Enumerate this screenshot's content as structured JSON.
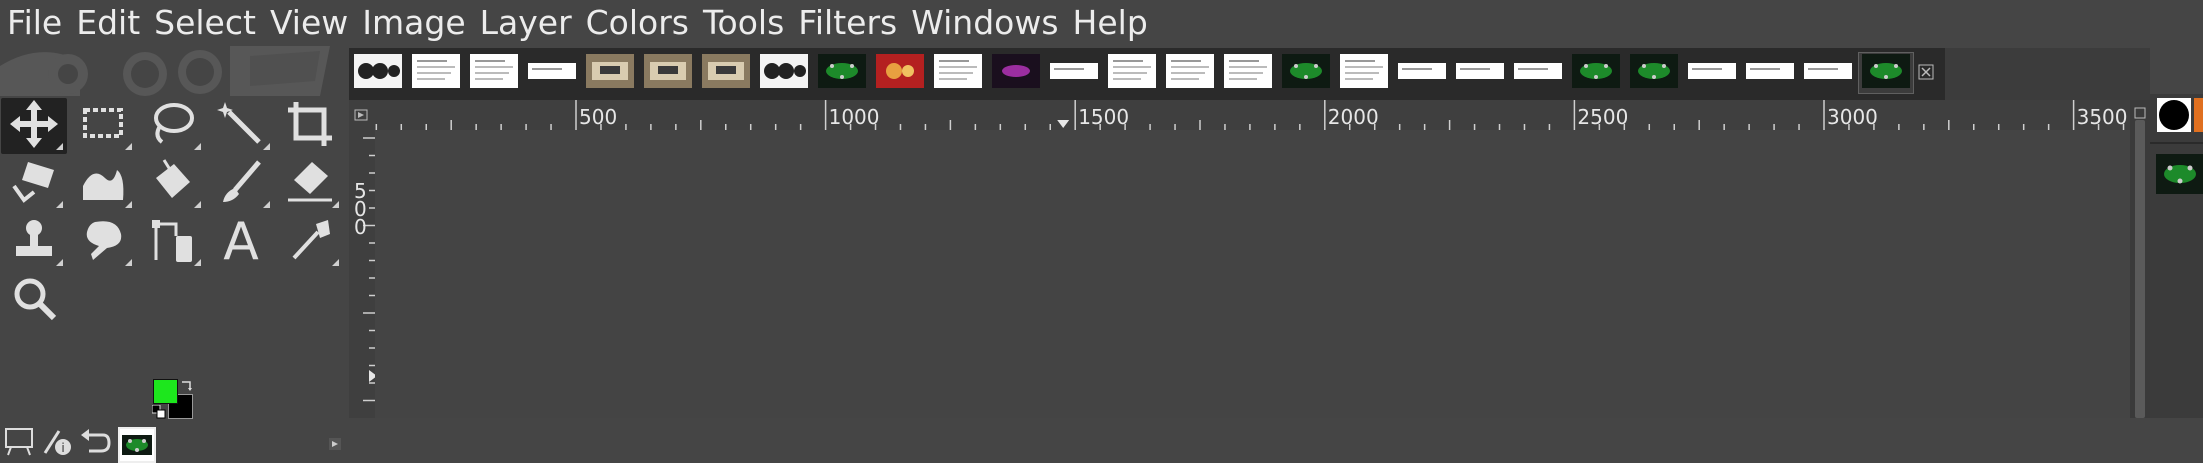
{
  "menubar": {
    "items": [
      "File",
      "Edit",
      "Select",
      "View",
      "Image",
      "Layer",
      "Colors",
      "Tools",
      "Filters",
      "Windows",
      "Help"
    ]
  },
  "toolbox": {
    "tools": [
      {
        "name": "move-tool",
        "icon": "move-icon",
        "active": true
      },
      {
        "name": "rect-select-tool",
        "icon": "rect-select-icon"
      },
      {
        "name": "free-select-tool",
        "icon": "lasso-icon"
      },
      {
        "name": "fuzzy-select-tool",
        "icon": "magic-wand-icon"
      },
      {
        "name": "crop-tool",
        "icon": "crop-icon"
      },
      {
        "name": "unified-transform-tool",
        "icon": "transform-icon"
      },
      {
        "name": "warp-transform-tool",
        "icon": "warp-icon"
      },
      {
        "name": "bucket-fill-tool",
        "icon": "bucket-icon"
      },
      {
        "name": "paintbrush-tool",
        "icon": "paintbrush-icon"
      },
      {
        "name": "eraser-tool",
        "icon": "eraser-icon"
      },
      {
        "name": "clone-tool",
        "icon": "stamp-icon"
      },
      {
        "name": "smudge-tool",
        "icon": "smudge-icon"
      },
      {
        "name": "paths-tool",
        "icon": "paths-icon"
      },
      {
        "name": "text-tool",
        "icon": "text-icon"
      },
      {
        "name": "color-picker-tool",
        "icon": "eyedropper-icon"
      },
      {
        "name": "zoom-tool",
        "icon": "magnifier-icon"
      }
    ],
    "foreground_color": "#1de71d",
    "background_color": "#000000",
    "text_tool_glyph": "A"
  },
  "image_tabs": {
    "count": 27,
    "active_index": 26
  },
  "ruler": {
    "h_labels": [
      "500",
      "1000",
      "1500",
      "2000",
      "2500",
      "3000",
      "3500"
    ],
    "v_labels": [
      "5",
      "0",
      "0"
    ]
  },
  "colors": {
    "background": "#454545",
    "tab_strip": "#2a2a2a",
    "ruler": "#3f3f3f",
    "canvas": "#444444",
    "foreground": "#1de71d"
  }
}
